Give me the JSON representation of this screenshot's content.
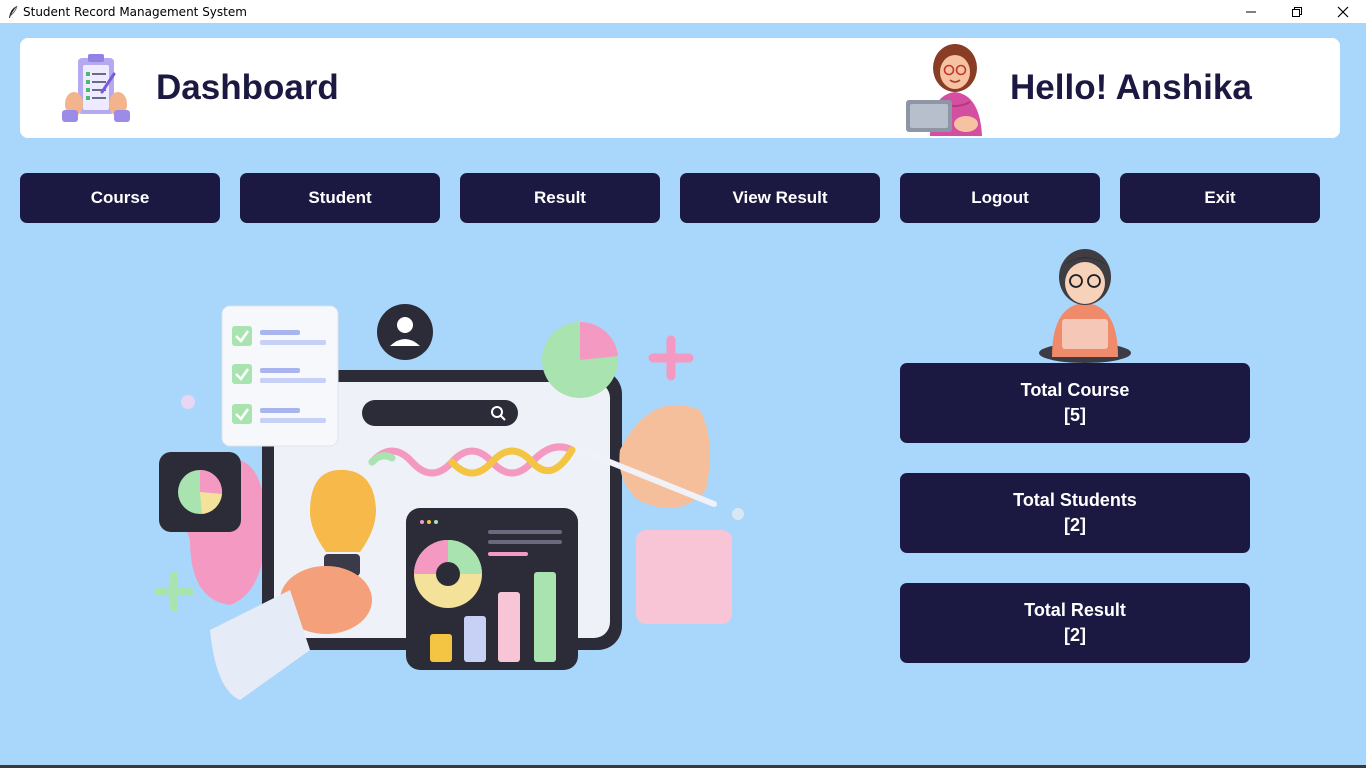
{
  "window": {
    "title": "Student Record Management System",
    "app_icon": "feather-icon",
    "controls": [
      "minimize-icon",
      "restore-icon",
      "close-icon"
    ]
  },
  "header": {
    "title": "Dashboard",
    "greeting": "Hello! Anshika",
    "logo_icon": "clipboard-checklist-icon",
    "avatar": "user-avatar-with-laptop"
  },
  "nav": {
    "course": "Course",
    "student": "Student",
    "result": "Result",
    "view_result": "View Result",
    "logout": "Logout",
    "exit": "Exit"
  },
  "stats": {
    "course": {
      "label": "Total Course",
      "value": "[5]"
    },
    "students": {
      "label": "Total Students",
      "value": "[2]"
    },
    "result": {
      "label": "Total Result",
      "value": "[2]"
    }
  },
  "colors": {
    "background": "#a9d6fb",
    "primary": "#1b1941",
    "header_bg": "#ffffff",
    "button_text": "#ffffff"
  }
}
